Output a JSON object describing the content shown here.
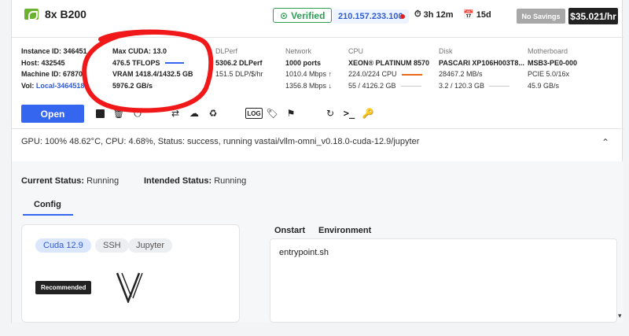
{
  "header": {
    "gpu_name": "8x B200",
    "verified": "Verified",
    "ip": "210.157.233.100",
    "duration": "3h 12m",
    "days": "15d",
    "savings": "No Savings",
    "price": "$35.021/hr"
  },
  "specs": {
    "instance": {
      "l1": "Instance ID: 346451",
      "l2": "Host: 432545",
      "l3": "Machine ID: 67870",
      "vol_label": "Vol: ",
      "vol_value": "Local-34645184"
    },
    "cuda": {
      "l1": "Max CUDA: 13.0",
      "l2": "476.5 TFLOPS",
      "l3": "VRAM 1418.4/1432.5 GB",
      "l4": "5976.2 GB/s"
    },
    "dlperf": {
      "title": "DLPerf",
      "l1": "5306.2 DLPerf",
      "l2": "151.5 DLP/$/hr"
    },
    "network": {
      "title": "Network",
      "l1": "1000 ports",
      "l2": "1010.4 Mbps ↑",
      "l3": "1356.8 Mbps ↓"
    },
    "cpu": {
      "title": "CPU",
      "l1": "XEON® PLATINUM 8570",
      "l2": "224.0/224 CPU",
      "l3": "55 / 4126.2 GB"
    },
    "disk": {
      "title": "Disk",
      "l1": "PASCARI XP106H003T8...",
      "l2": "28467.2 MB/s",
      "l3": "3.2 / 120.3 GB"
    },
    "mb": {
      "title": "Motherboard",
      "l1": "MSB3-PE0-000",
      "l2": "PCIE 5.0/16x",
      "l3": "45.9 GB/s"
    }
  },
  "actions": {
    "open": "Open",
    "log": "LOG"
  },
  "status_line": "GPU: 100% 48.62°C, CPU: 4.68%, Status: success, running vastai/vllm-omni_v0.18.0-cuda-12.9/jupyter",
  "status": {
    "current_label": "Current Status:",
    "current_value": "Running",
    "intended_label": "Intended Status:",
    "intended_value": "Running"
  },
  "tabs": {
    "config": "Config"
  },
  "config": {
    "chips": [
      "Cuda 12.9",
      "SSH",
      "Jupyter"
    ],
    "recommended": "Recommended"
  },
  "right_tabs": {
    "onstart": "Onstart",
    "environment": "Environment"
  },
  "onstart_value": "entrypoint.sh",
  "colors": {
    "accent": "#3566f0",
    "verified": "#2e9d55",
    "annotation": "#f01818"
  }
}
